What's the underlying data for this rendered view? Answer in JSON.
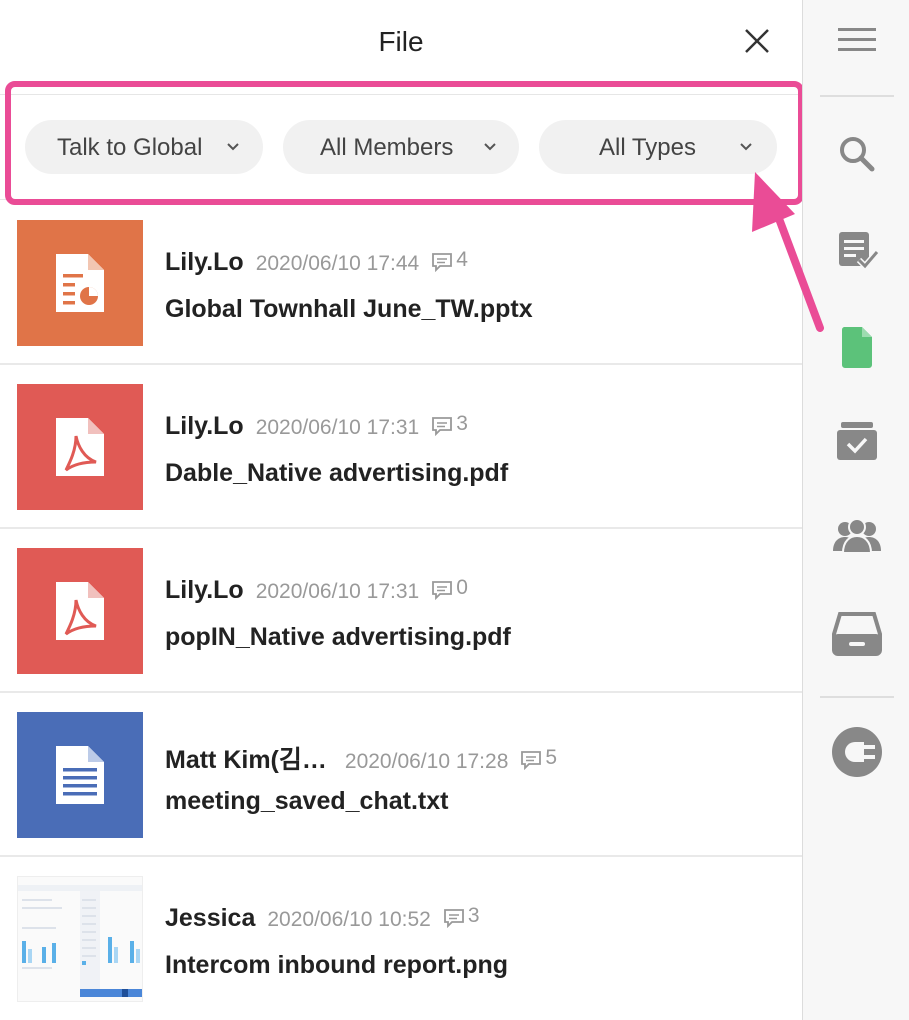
{
  "header": {
    "title": "File"
  },
  "filters": {
    "channel": "Talk to Global",
    "members": "All Members",
    "types": "All Types"
  },
  "files": [
    {
      "author": "Lily.Lo",
      "time": "2020/06/10 17:44",
      "comments": "4",
      "name": "Global Townhall June_TW.pptx",
      "icon": "pptx-file-icon",
      "color": "#e07448"
    },
    {
      "author": "Lily.Lo",
      "time": "2020/06/10 17:31",
      "comments": "3",
      "name": "Dable_Native advertising.pdf",
      "icon": "pdf-file-icon",
      "color": "#e05a55"
    },
    {
      "author": "Lily.Lo",
      "time": "2020/06/10 17:31",
      "comments": "0",
      "name": "popIN_Native advertising.pdf",
      "icon": "pdf-file-icon",
      "color": "#e05a55"
    },
    {
      "author": "Matt Kim(김…",
      "time": "2020/06/10 17:28",
      "comments": "5",
      "name": "meeting_saved_chat.txt",
      "icon": "txt-file-icon",
      "color": "#4a6db7"
    },
    {
      "author": "Jessica",
      "time": "2020/06/10 10:52",
      "comments": "3",
      "name": "Intercom inbound report.png",
      "icon": "image-thumbnail",
      "color": "#ffffff"
    }
  ],
  "sidebar": {
    "icons": [
      "menu-icon",
      "search-icon",
      "task-icon",
      "file-icon",
      "archive-icon",
      "members-icon",
      "inbox-icon",
      "plugin-icon"
    ],
    "active": "file-icon",
    "active_color": "#5cc27a"
  },
  "colors": {
    "highlight": "#ea4c96",
    "pill_bg": "#f1f1f1"
  }
}
